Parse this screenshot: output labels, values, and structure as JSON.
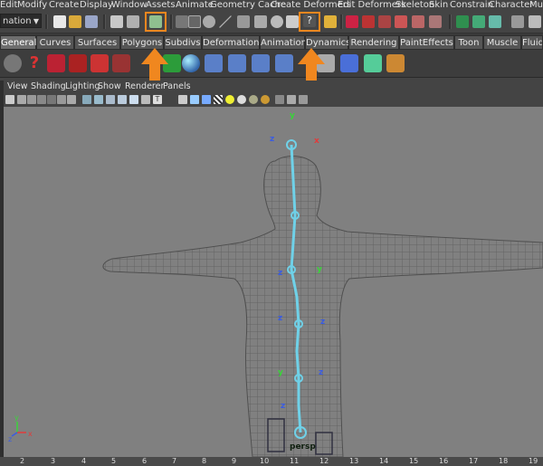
{
  "menus": [
    "Edit",
    "Modify",
    "Create",
    "Display",
    "Window",
    "Assets",
    "Animate",
    "Geometry Cache",
    "Create Deformers",
    "Edit Deformers",
    "Skeleton",
    "Skin",
    "Constrain",
    "Character",
    "Muscle"
  ],
  "mode_selector": {
    "value": "nation"
  },
  "shelf_tabs": [
    "General",
    "Curves",
    "Surfaces",
    "Polygons",
    "Subdivs",
    "Deformation",
    "Animation",
    "Dynamics",
    "Rendering",
    "PaintEffects",
    "Toon",
    "Muscle",
    "Fluids"
  ],
  "active_tab": "General",
  "viewport_menus": [
    "View",
    "Shading",
    "Lighting",
    "Show",
    "Renderer",
    "Panels"
  ],
  "camera_label": "persp",
  "ruler_ticks": [
    "2",
    "3",
    "4",
    "5",
    "6",
    "7",
    "8",
    "9",
    "10",
    "11",
    "12",
    "13",
    "14",
    "15",
    "16",
    "17",
    "18",
    "19"
  ],
  "joint_axis_labels": {
    "x": "x",
    "y": "y",
    "z": "z"
  },
  "colors": {
    "highlight": "#f0871f",
    "joint": "#6fd1e8",
    "axis_x": "#e23a3a",
    "axis_y": "#3ad23a",
    "axis_z": "#3a5ce2"
  },
  "icons": [
    "new-scene-icon",
    "open-scene-icon",
    "save-scene-icon",
    "select-hierarchy-icon",
    "help-icon",
    "snap-icon",
    "render-icon",
    "ipr-render-icon",
    "render-settings-icon",
    "hypershade-icon"
  ]
}
